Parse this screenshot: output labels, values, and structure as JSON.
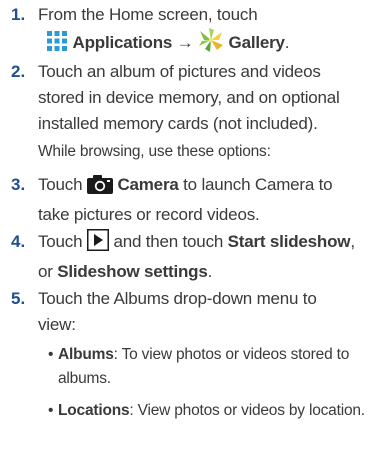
{
  "steps": [
    {
      "num": "1.",
      "line1": "From the Home screen, touch",
      "app_label": "Applications",
      "arrow": "→",
      "gallery_label": "Gallery",
      "period": "."
    },
    {
      "num": "2.",
      "line1": "Touch an album of pictures and videos",
      "line2": "stored in device memory, and on optional",
      "line3": "installed memory cards (not included).",
      "note": "While browsing, use these options:"
    },
    {
      "num": "3.",
      "pre": "Touch",
      "camera_label": "Camera",
      "post": "to launch Camera to",
      "line2": "take pictures or record videos."
    },
    {
      "num": "4.",
      "pre": "Touch",
      "post": "and then touch",
      "start_label": "Start slideshow",
      "comma": ",",
      "line2_pre": "or",
      "settings_label": "Slideshow settings",
      "period": "."
    },
    {
      "num": "5.",
      "line1": "Touch the Albums drop-down menu to",
      "line2": "view:",
      "bullets": [
        {
          "label": "Albums",
          "text": ": To view photos or videos stored to",
          "cont": "albums."
        },
        {
          "label": "Locations",
          "text": ": View photos or videos by location."
        }
      ]
    }
  ],
  "colors": {
    "number": "#1f4f8f",
    "text": "#3a3a3a",
    "applications_icon": "#2a9ad6",
    "gallery_icon_green": "#7cc142",
    "gallery_icon_yellow": "#f4d33a",
    "camera_icon": "#1a1a1a"
  },
  "icons": [
    "applications-grid-icon",
    "gallery-icon",
    "camera-icon",
    "play-icon"
  ]
}
